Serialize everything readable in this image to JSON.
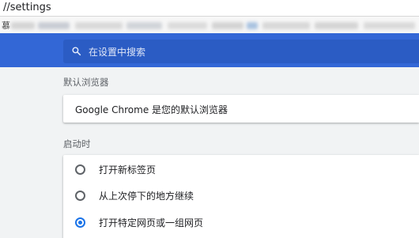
{
  "address_bar": {
    "url": "//settings"
  },
  "bookmarks_bar": {
    "first_item": "慕"
  },
  "header": {
    "search": {
      "placeholder": "在设置中搜索",
      "icon": "search-icon"
    },
    "colors": {
      "header_bg": "#3367d6",
      "search_bg": "#2b5cc4"
    }
  },
  "default_browser": {
    "section_title": "默认浏览器",
    "status_text": "Google Chrome 是您的默认浏览器"
  },
  "on_startup": {
    "section_title": "启动时",
    "options": [
      {
        "label": "打开新标签页",
        "selected": false
      },
      {
        "label": "从上次停下的地方继续",
        "selected": false
      },
      {
        "label": "打开特定网页或一组网页",
        "selected": true
      }
    ],
    "accent_color": "#1a73e8"
  }
}
